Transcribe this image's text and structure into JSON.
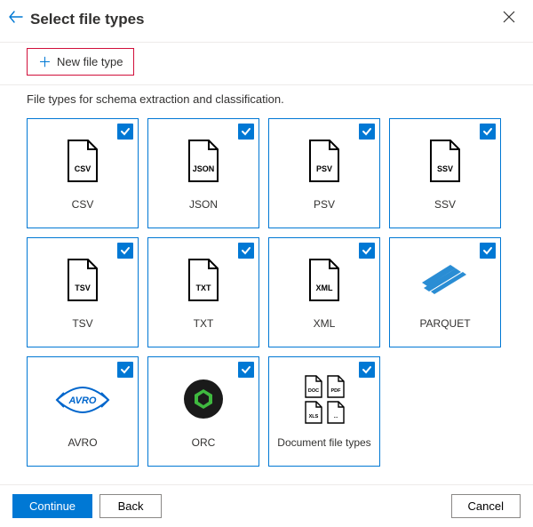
{
  "header": {
    "title": "Select file types"
  },
  "toolbar": {
    "new_file_type": "New file type"
  },
  "description": "File types for schema extraction and classification.",
  "tiles": [
    {
      "label": "CSV",
      "badge": "CSV",
      "kind": "doc"
    },
    {
      "label": "JSON",
      "badge": "JSON",
      "kind": "doc"
    },
    {
      "label": "PSV",
      "badge": "PSV",
      "kind": "doc"
    },
    {
      "label": "SSV",
      "badge": "SSV",
      "kind": "doc"
    },
    {
      "label": "TSV",
      "badge": "TSV",
      "kind": "doc"
    },
    {
      "label": "TXT",
      "badge": "TXT",
      "kind": "doc"
    },
    {
      "label": "XML",
      "badge": "XML",
      "kind": "doc"
    },
    {
      "label": "PARQUET",
      "kind": "parquet"
    },
    {
      "label": "AVRO",
      "kind": "avro"
    },
    {
      "label": "ORC",
      "kind": "orc"
    },
    {
      "label": "Document file types",
      "kind": "docgrid",
      "minis": [
        "DOC",
        "PDF",
        "XLS",
        "..."
      ]
    }
  ],
  "footer": {
    "continue": "Continue",
    "back": "Back",
    "cancel": "Cancel"
  }
}
